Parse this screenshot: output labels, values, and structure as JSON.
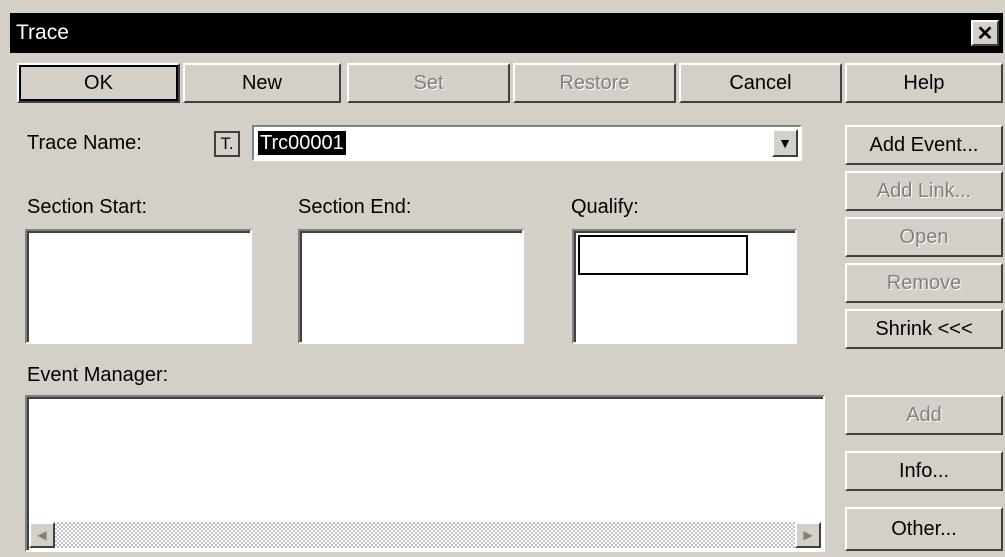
{
  "window": {
    "title": "Trace",
    "close_glyph": "✕"
  },
  "toolbar": {
    "ok": "OK",
    "new": "New",
    "set": "Set",
    "restore": "Restore",
    "cancel": "Cancel",
    "help": "Help"
  },
  "trace_name": {
    "label": "Trace Name:",
    "icon_glyph": "T.",
    "value": "Trc00001",
    "dropdown_glyph": "▼"
  },
  "side": {
    "add_event": "Add Event...",
    "add_link": "Add Link...",
    "open": "Open",
    "remove": "Remove",
    "shrink": "Shrink <<<",
    "add": "Add",
    "info": "Info...",
    "other": "Other..."
  },
  "sections": {
    "start": "Section Start:",
    "end": "Section End:",
    "qualify": "Qualify:"
  },
  "event_manager": {
    "label": "Event Manager:",
    "left_arrow": "◀",
    "right_arrow": "▶"
  }
}
